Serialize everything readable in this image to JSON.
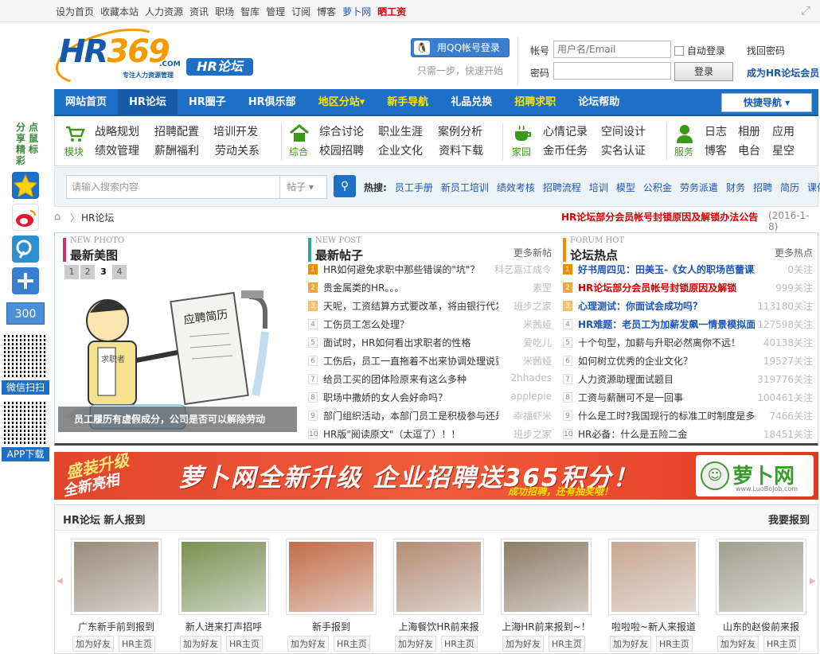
{
  "topbar": {
    "links": [
      "设为首页",
      "收藏本站",
      "人力资源",
      "资讯",
      "职场",
      "智库",
      "管理",
      "订阅",
      "博客"
    ],
    "luobo": "萝卜网",
    "jobs": "晒工资"
  },
  "brand": {
    "hr": "HR",
    "num": "369",
    "com": ".COM",
    "slogan": "专注人力资源管理",
    "badge": "HR论坛"
  },
  "login": {
    "qq_button": "用QQ帐号登录",
    "qq_tip": "只需一步，快速开始",
    "user_label": "帐号",
    "user_placeholder": "用户名/Email",
    "pass_label": "密码",
    "auto_login": "自动登录",
    "login_button": "登录",
    "find_password": "找回密码",
    "register": "成为HR论坛会员"
  },
  "nav": {
    "items": [
      "网站首页",
      "HR论坛",
      "HR圈子",
      "HR俱乐部",
      "地区分站▾",
      "新手导航",
      "礼品兑换",
      "招聘求职",
      "论坛帮助"
    ],
    "quick": "快捷导航 ▾"
  },
  "subnav": {
    "modules": {
      "label": "模块",
      "links": [
        "战略规划",
        "招聘配置",
        "培训开发",
        "绩效管理",
        "薪酬福利",
        "劳动关系"
      ]
    },
    "general": {
      "label": "综合",
      "links": [
        "综合讨论",
        "职业生涯",
        "案例分析",
        "校园招聘",
        "企业文化",
        "资料下载"
      ]
    },
    "home": {
      "label": "家园",
      "links": [
        "心情记录",
        "空间设计",
        "金币任务",
        "实名认证"
      ]
    },
    "service": {
      "label": "服务",
      "links": [
        "日志",
        "相册",
        "应用",
        "博客",
        "电台",
        "星空"
      ]
    }
  },
  "search": {
    "placeholder": "请输入搜索内容",
    "type": "帖子 ▾",
    "hot_label": "热搜:",
    "hot": [
      "员工手册",
      "新员工培训",
      "绩效考核",
      "招聘流程",
      "培训",
      "模型",
      "公积金",
      "劳务派遣",
      "财务",
      "招聘",
      "简历",
      "课件"
    ]
  },
  "crumb": {
    "here": "HR论坛",
    "notice": "HR论坛部分会员帐号封锁原因及解锁办法公告",
    "date": "(2016-1-8)"
  },
  "photo": {
    "en": "NEW PHOTO",
    "cn": "最新美图",
    "pages": [
      "1",
      "2",
      "3",
      "4"
    ],
    "caption": "员工履历有虚假成分，公司是否可以解除劳动",
    "resume_text": "应聘简历",
    "worker_text": "求职者"
  },
  "posts": {
    "en": "NEW POST",
    "cn": "最新帖子",
    "more": "更多新帖",
    "items": [
      {
        "n": "1",
        "t": "HR如何避免求职中那些错误的\"坑\"？",
        "a": "科艺嘉江成令"
      },
      {
        "n": "2",
        "t": "贵金属类的HR。。。",
        "a": "素罡"
      },
      {
        "n": "3",
        "t": "天呢，工资结算方式要改革，将由银行代发！",
        "a": "班步之家"
      },
      {
        "n": "4",
        "t": "工伤员工怎么处理？",
        "a": "米茜娅"
      },
      {
        "n": "5",
        "t": "面试时，HR如何看出求职者的性格",
        "a": "爱吃儿"
      },
      {
        "n": "6",
        "t": "工伤后，员工一直拖着不出来协调处理说要等",
        "a": "米茜娅"
      },
      {
        "n": "7",
        "t": "给员工买的团体险原来有这么多种",
        "a": "2hhades"
      },
      {
        "n": "8",
        "t": "职场中撒娇的女人会好命吗？",
        "a": "applepie"
      },
      {
        "n": "9",
        "t": "部门组织活动，本部门员工是积极参与还是看",
        "a": "幸福虾米"
      },
      {
        "n": "10",
        "t": "HR版\"阅读原文\"（太逗了）！！",
        "a": "班步之家"
      }
    ]
  },
  "hot": {
    "en": "FORUM HOT",
    "cn": "论坛热点",
    "more": "更多热点",
    "items": [
      {
        "n": "1",
        "t": "好书周四见：田美玉-《女人的职场芭蕾课》",
        "a": "0关注",
        "c": "#1a55b8",
        "b": true
      },
      {
        "n": "2",
        "t": "HR论坛部分会员帐号封锁原因及解锁",
        "a": "999关注",
        "c": "#d60000",
        "b": true
      },
      {
        "n": "3",
        "t": "心理测试：你面试会成功吗？",
        "a": "113180关注",
        "c": "#1a55b8",
        "b": true
      },
      {
        "n": "4",
        "t": "HR难题：老员工为加薪发飙一情景模拟面",
        "a": "127598关注",
        "c": "#1a55b8",
        "b": true
      },
      {
        "n": "5",
        "t": "十个句型，加薪与升职必然离你不远！",
        "a": "40138关注",
        "c": "#333",
        "b": false
      },
      {
        "n": "6",
        "t": "如何树立优秀的企业文化？",
        "a": "19527关注",
        "c": "#333",
        "b": false
      },
      {
        "n": "7",
        "t": "人力资源助理面试题目",
        "a": "319776关注",
        "c": "#333",
        "b": false
      },
      {
        "n": "8",
        "t": "工资与薪酬可不是一回事",
        "a": "100461关注",
        "c": "#333",
        "b": false
      },
      {
        "n": "9",
        "t": "什么是工时?我国现行的标准工时制度是多少?",
        "a": "7466关注",
        "c": "#333",
        "b": false
      },
      {
        "n": "10",
        "t": "HR必备：什么是五险二金",
        "a": "18451关注",
        "c": "#333",
        "b": false
      }
    ]
  },
  "banner": {
    "l1": "盛装升级",
    "l2": "全新亮相",
    "main": "萝卜网全新升级 企业招聘送365积分！",
    "sub": "成功招聘，还有抽奖哦！",
    "logo": "萝卜网",
    "url": "www.LuoBoJob.com"
  },
  "newbie": {
    "title": "HR论坛 新人报到",
    "register": "我要报到",
    "add": "加为好友",
    "home": "HR主页",
    "cards": [
      {
        "name": "广东新手前到报到",
        "color": "#9a8b7a"
      },
      {
        "name": "新人进来打声招呼",
        "color": "#7a9050"
      },
      {
        "name": "新手报到",
        "color": "#c26c46"
      },
      {
        "name": "上海餐饮HR前来报",
        "color": "#b58d74"
      },
      {
        "name": "上海HR前来报到~！",
        "color": "#8e7b63"
      },
      {
        "name": "啦啦啦~新人来报道",
        "color": "#c9a890"
      },
      {
        "name": "山东的赵俊前来报",
        "color": "#a0a090"
      }
    ]
  },
  "sidebar": {
    "share": [
      "分",
      "点",
      "享",
      "鼠",
      "精",
      "标",
      "彩"
    ],
    "count": "300",
    "wechat": "微信扫扫",
    "app": "APP下载"
  }
}
